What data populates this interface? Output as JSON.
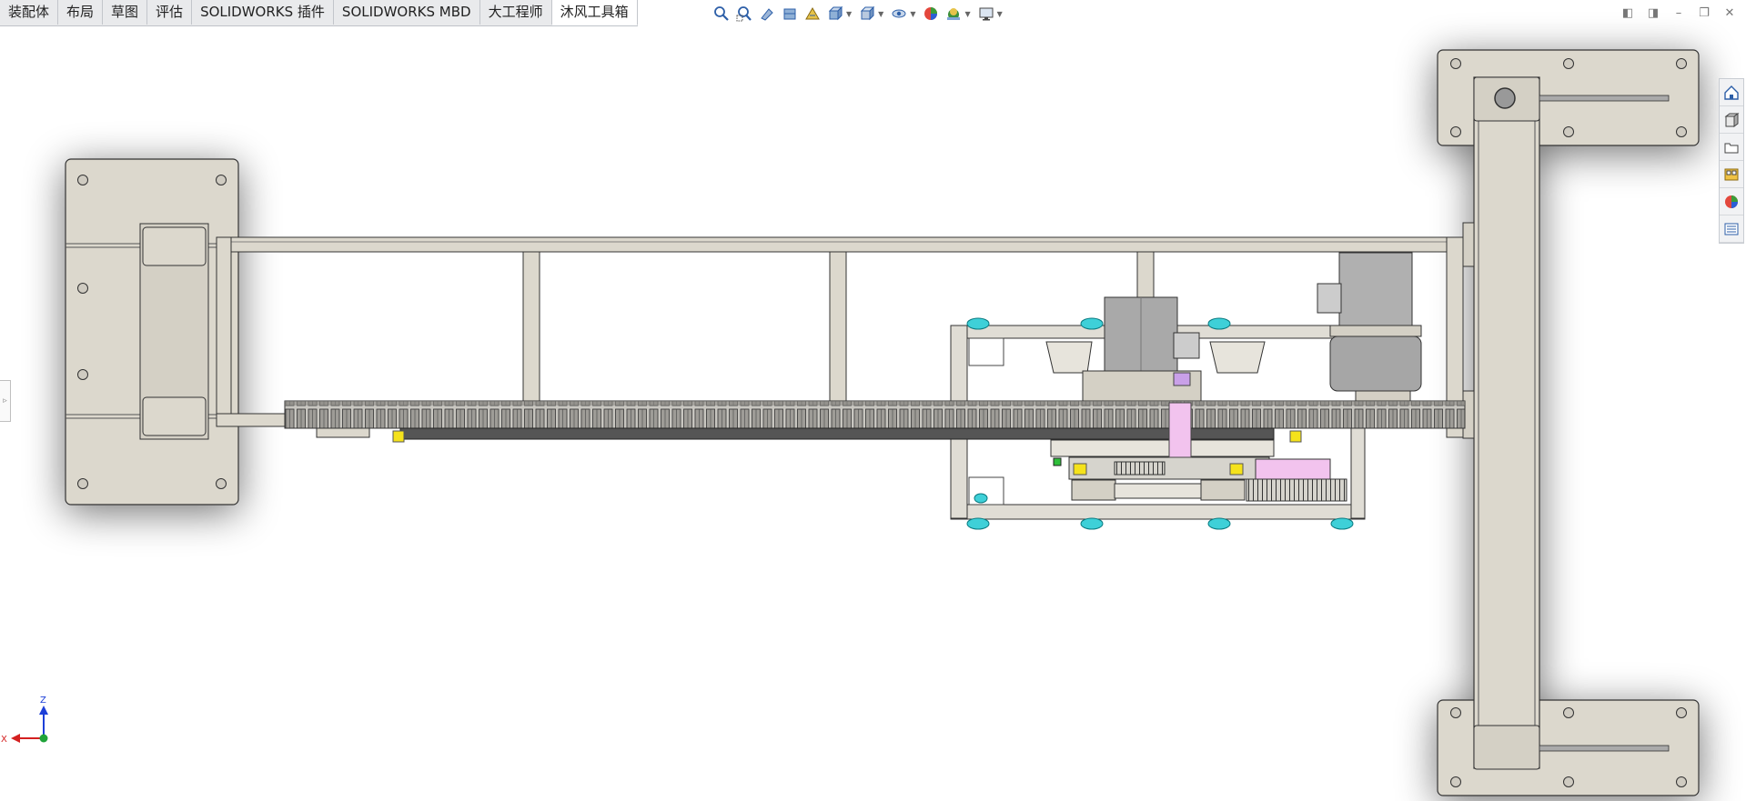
{
  "tabs": [
    {
      "label": "装配体",
      "active": false
    },
    {
      "label": "布局",
      "active": false
    },
    {
      "label": "草图",
      "active": false
    },
    {
      "label": "评估",
      "active": false
    },
    {
      "label": "SOLIDWORKS 插件",
      "active": false
    },
    {
      "label": "SOLIDWORKS MBD",
      "active": false
    },
    {
      "label": "大工程师",
      "active": false
    },
    {
      "label": "沐风工具箱",
      "active": true
    }
  ],
  "heads_up_toolbar": [
    "zoom-to-fit-icon",
    "zoom-to-area-icon",
    "previous-view-icon",
    "section-view-icon",
    "dynamic-annotation-icon",
    "view-orientation-icon",
    "display-style-icon",
    "hide-show-items-icon",
    "edit-appearance-icon",
    "apply-scene-icon",
    "view-settings-icon"
  ],
  "task_pane": [
    "solidworks-resources-icon",
    "design-library-icon",
    "file-explorer-icon",
    "view-palette-icon",
    "appearances-icon",
    "custom-properties-icon"
  ],
  "triad": {
    "z_label": "Z",
    "x_label": "X"
  },
  "colors": {
    "part_fill": "#dcd8cd",
    "edge": "#333333",
    "chain": "#4a4a4a",
    "caster": "#3ed0d8",
    "pink_part": "#f2c3ee",
    "yellow_part": "#f5e21b",
    "motor": "#a9a9a9",
    "axis_x": "#d42020",
    "axis_y": "#1fa33a",
    "axis_z": "#1d3fd8"
  }
}
